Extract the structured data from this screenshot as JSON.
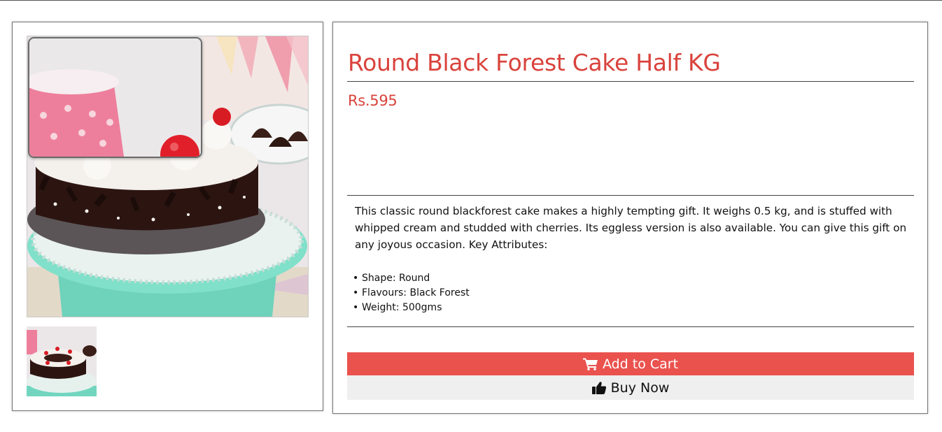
{
  "product": {
    "title": "Round Black Forest Cake Half KG",
    "price": "Rs.595",
    "description": "This classic round blackforest cake makes a highly tempting gift. It weighs 0.5 kg, and is stuffed with whipped cream and studded with cherries. Its eggless version is also available. You can give this gift on any joyous occasion. Key Attributes:",
    "attributes": [
      "Shape: Round",
      "Flavours: Black Forest",
      "Weight: 500gms"
    ]
  },
  "actions": {
    "add_to_cart_label": "Add to Cart",
    "add_to_cart_icon": "shopping-cart-icon",
    "buy_now_label": "Buy Now",
    "buy_now_icon": "thumbs-up-icon"
  },
  "colors": {
    "title": "#d9433c",
    "add_to_cart_bg": "#ea524e",
    "buy_now_bg": "#efefef"
  }
}
